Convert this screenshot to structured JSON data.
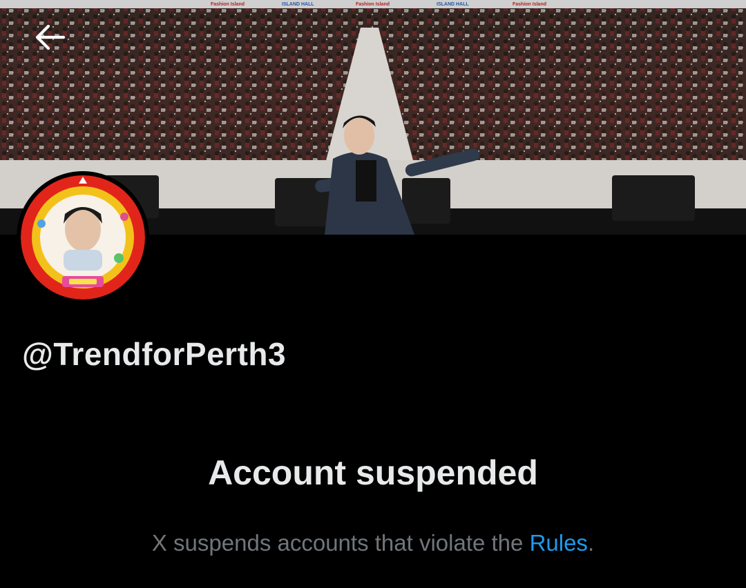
{
  "header": {
    "back_icon": "arrow-left-icon"
  },
  "banner": {
    "description_icon": "banner-photo",
    "signs": [
      "Fashion Island",
      "ISLAND HALL",
      "Fashion Island",
      "ISLAND HALL",
      "Fashion Island"
    ]
  },
  "profile": {
    "avatar_icon": "avatar-photo",
    "handle": "@TrendforPerth3"
  },
  "notice": {
    "title": "Account suspended",
    "desc_prefix": "X suspends accounts that violate the ",
    "rules_link": "Rules",
    "desc_suffix": "."
  },
  "colors": {
    "background": "#000000",
    "text_primary": "#e7e9ea",
    "text_secondary": "#71767b",
    "link": "#1d9bf0"
  }
}
